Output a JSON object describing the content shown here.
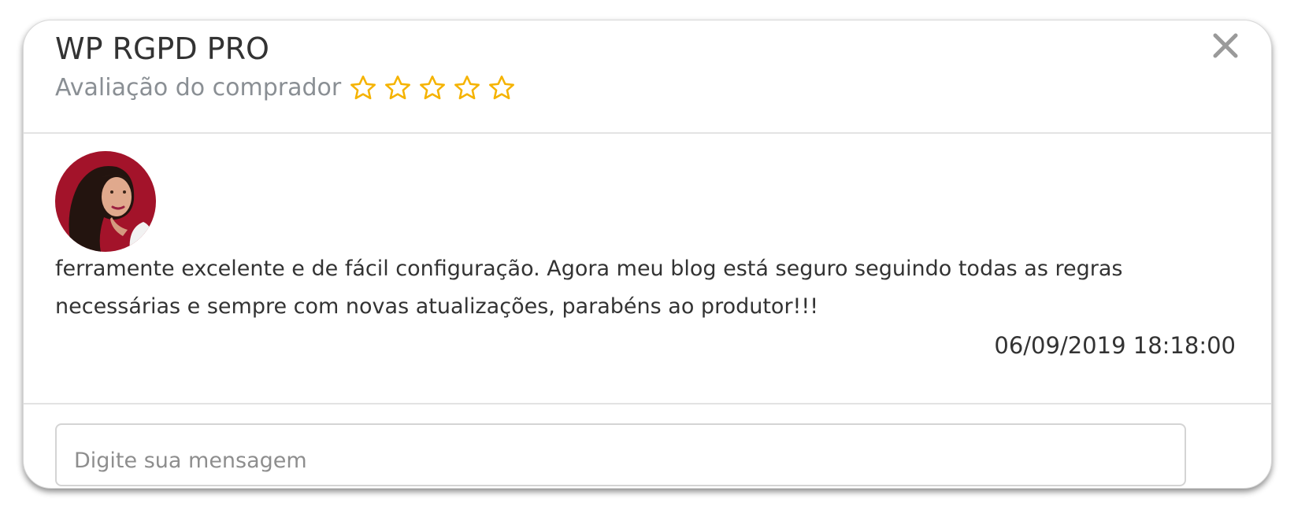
{
  "modal": {
    "title": "WP RGPD PRO",
    "close_icon": "close-icon",
    "subtitle": "Avaliação do comprador",
    "rating": {
      "value": 0,
      "max": 5,
      "star_icon": "star-outline-icon",
      "color": "#f5b301"
    }
  },
  "review": {
    "avatar_icon": "user-avatar",
    "text": "ferramente excelente e de fácil configuração. Agora meu blog está seguro seguindo todas as regras necessárias e sempre com novas atualizações, parabéns ao produtor!!!",
    "date": "06/09/2019 18:18:00"
  },
  "message": {
    "value": "",
    "placeholder": "Digite sua mensagem"
  },
  "colors": {
    "title": "#333333",
    "subtitle": "#8a8f94",
    "divider": "#e3e3e3",
    "star": "#f5b301"
  }
}
